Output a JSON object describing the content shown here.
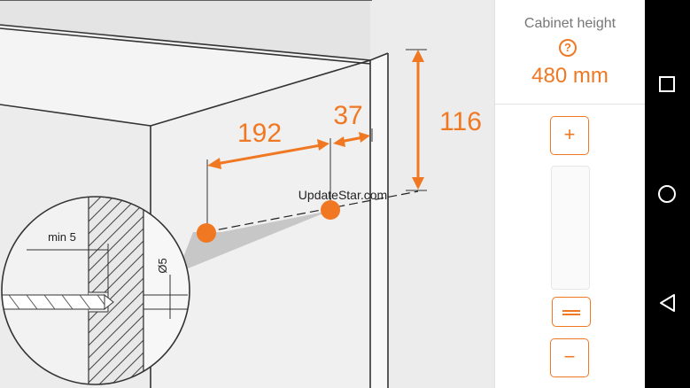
{
  "illustration": {
    "dim_192": "192",
    "dim_37": "37",
    "dim_116": "116",
    "min_label": "min 5",
    "diameter_label": "Ø5",
    "watermark": "UpdateStar.com",
    "accent_color": "#f07822"
  },
  "panel": {
    "title": "Cabinet height",
    "help_icon": "?",
    "height_value": "480 mm",
    "plus_label": "+",
    "minus_label": "−",
    "slider_icon": "drag-handle-icon"
  },
  "navbar": {
    "buttons": [
      "recents-icon",
      "home-icon",
      "back-icon"
    ]
  }
}
